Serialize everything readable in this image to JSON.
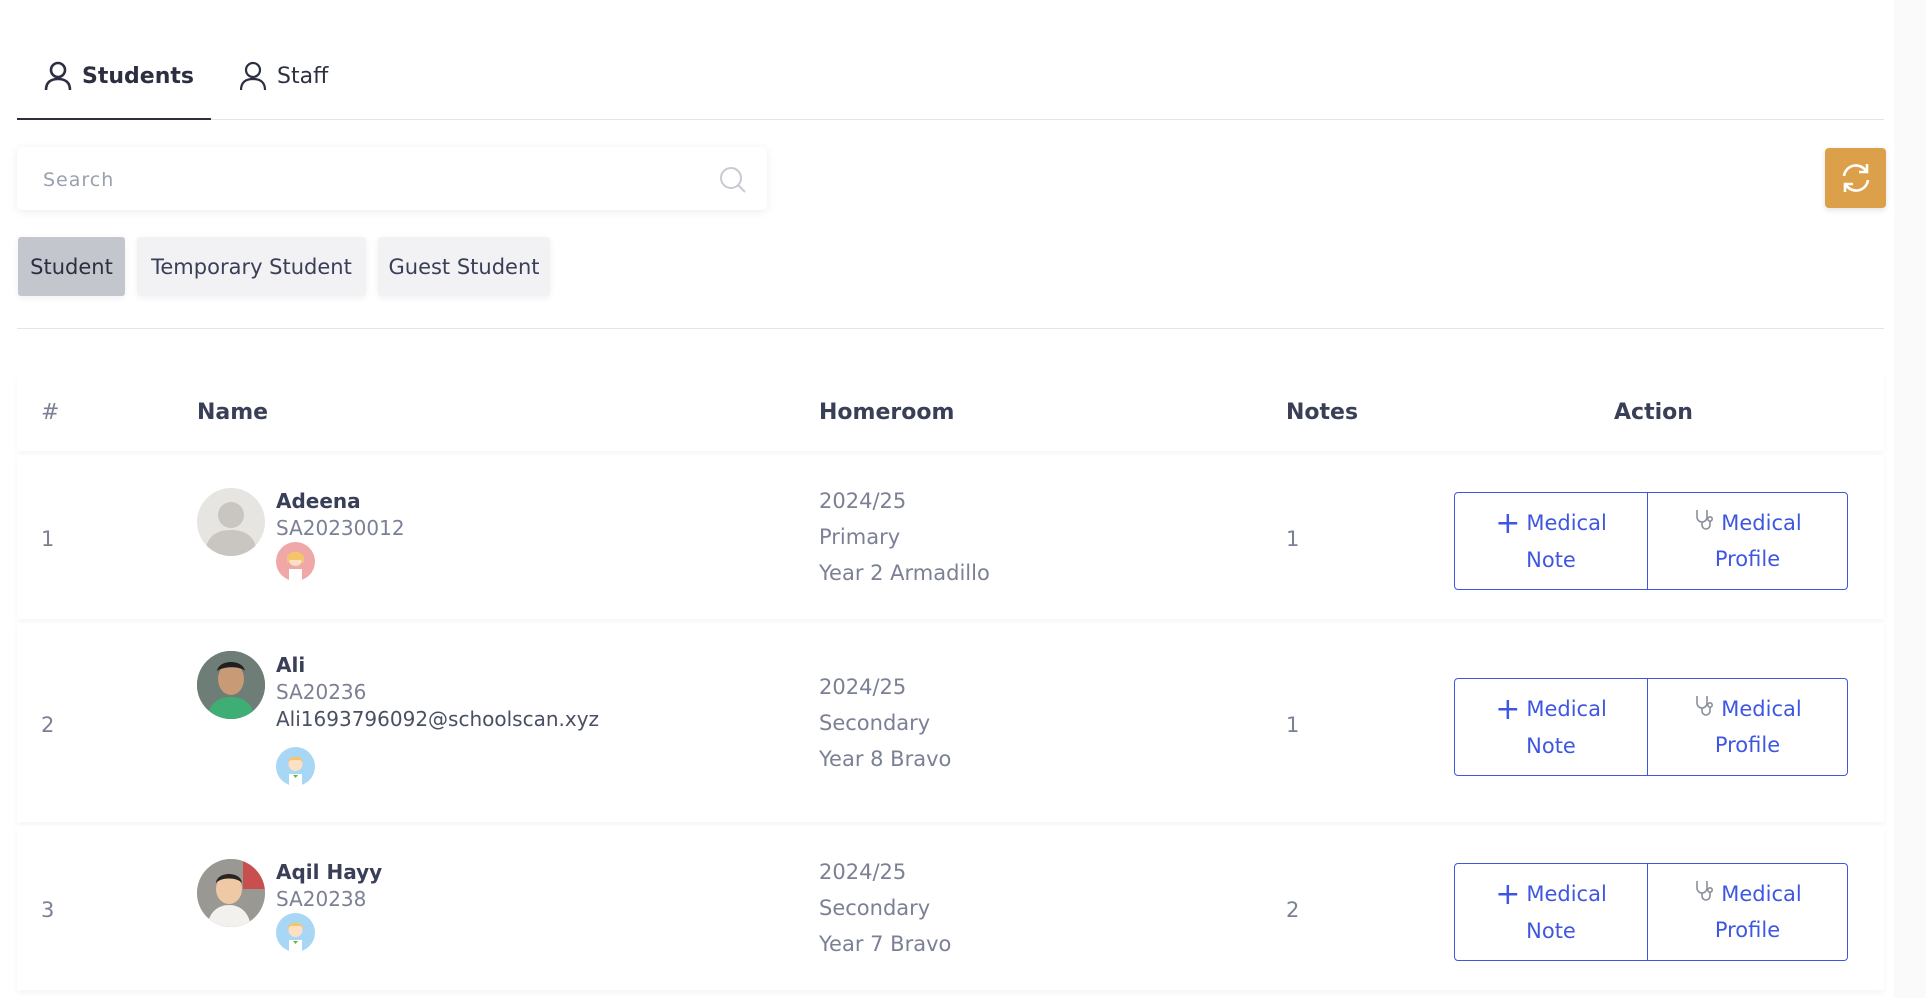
{
  "tabs": [
    {
      "label": "Students",
      "active": true,
      "icon": "user-icon"
    },
    {
      "label": "Staff",
      "active": false,
      "icon": "user-icon"
    }
  ],
  "search": {
    "placeholder": "Search",
    "value": ""
  },
  "filters": [
    {
      "label": "Student",
      "selected": true
    },
    {
      "label": "Temporary Student",
      "selected": false
    },
    {
      "label": "Guest Student",
      "selected": false
    }
  ],
  "table": {
    "columns": [
      "#",
      "Name",
      "Homeroom",
      "Notes",
      "Action"
    ],
    "rows": [
      {
        "num": "1",
        "name": "Adeena",
        "id": "SA20230012",
        "email": "",
        "homeroom": [
          "2024/25",
          "Primary",
          "Year 2 Armadillo"
        ],
        "notes": "1",
        "gender": "female"
      },
      {
        "num": "2",
        "name": "Ali",
        "id": "SA20236",
        "email": "Ali1693796092@schoolscan.xyz",
        "homeroom": [
          "2024/25",
          "Secondary",
          "Year 8 Bravo"
        ],
        "notes": "1",
        "gender": "male"
      },
      {
        "num": "3",
        "name": "Aqil Hayy",
        "id": "SA20238",
        "email": "",
        "homeroom": [
          "2024/25",
          "Secondary",
          "Year 7 Bravo"
        ],
        "notes": "2",
        "gender": "male"
      }
    ],
    "actions": {
      "note_line1": "Medical",
      "note_line2": "Note",
      "profile_line1": "Medical",
      "profile_line2": "Profile"
    }
  },
  "colors": {
    "accent": "#3f57e0",
    "refresh": "#dda04a",
    "chip_selected": "#c3c6cc"
  }
}
